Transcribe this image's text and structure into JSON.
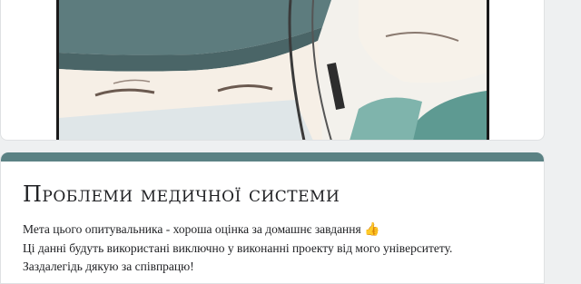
{
  "form": {
    "title": "Проблеми медичної системи",
    "description": [
      "Мета цього опитувальника - хороша оцінка за домашнє завдання",
      "Ці данні будуть використані виключно у виконанні проекту від мого університету.",
      "Заздалегідь дякую за співпрацю!"
    ],
    "description_emoji": "👍"
  },
  "colors": {
    "accent": "#5b8284",
    "background": "#eef0f1"
  }
}
